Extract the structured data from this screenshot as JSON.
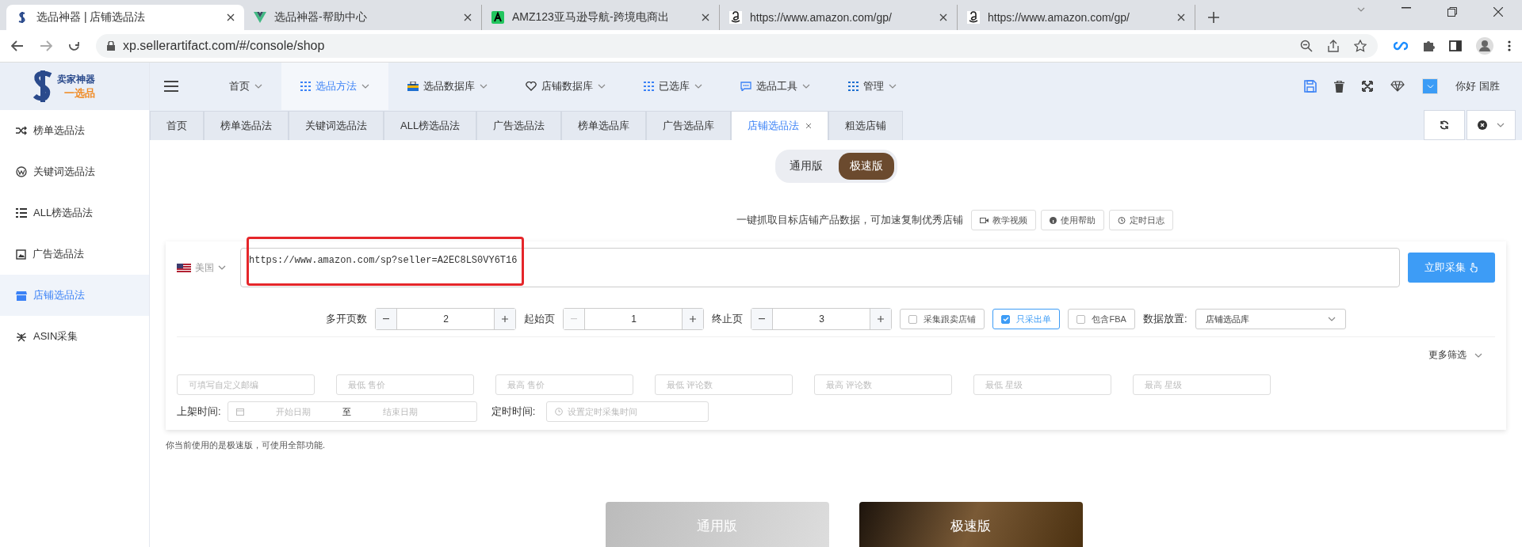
{
  "browser": {
    "tabs": [
      {
        "title": "选品神器 | 店铺选品法",
        "selected": true
      },
      {
        "title": "选品神器-帮助中心",
        "selected": false
      },
      {
        "title": "AMZ123亚马逊导航-跨境电商出",
        "selected": false
      },
      {
        "title": "https://www.amazon.com/gp/",
        "selected": false
      },
      {
        "title": "https://www.amazon.com/gp/",
        "selected": false
      }
    ],
    "address": "xp.sellerartifact.com/#/console/shop"
  },
  "header": {
    "logo_top": "卖家神器",
    "logo_bottom": "一选品",
    "nav": [
      {
        "label": "首页",
        "selected": false
      },
      {
        "label": "选品方法",
        "selected": true
      },
      {
        "label": "选品数据库",
        "selected": false
      },
      {
        "label": "店铺数据库",
        "selected": false
      },
      {
        "label": "已选库",
        "selected": false
      },
      {
        "label": "选品工具",
        "selected": false
      },
      {
        "label": "管理",
        "selected": false
      }
    ],
    "greeting": "你好 国胜"
  },
  "sidebar": {
    "items": [
      {
        "label": "榜单选品法",
        "selected": false
      },
      {
        "label": "关键词选品法",
        "selected": false
      },
      {
        "label": "ALL榜选品法",
        "selected": false
      },
      {
        "label": "广告选品法",
        "selected": false
      },
      {
        "label": "店铺选品法",
        "selected": true
      },
      {
        "label": "ASIN采集",
        "selected": false
      }
    ]
  },
  "page_tabs": [
    {
      "label": "首页",
      "selected": false
    },
    {
      "label": "榜单选品法",
      "selected": false
    },
    {
      "label": "关键词选品法",
      "selected": false
    },
    {
      "label": "ALL榜选品法",
      "selected": false
    },
    {
      "label": "广告选品法",
      "selected": false
    },
    {
      "label": "榜单选品库",
      "selected": false
    },
    {
      "label": "广告选品库",
      "selected": false
    },
    {
      "label": "店铺选品法",
      "selected": true
    },
    {
      "label": "粗选店铺",
      "selected": false
    }
  ],
  "mode_toggle": [
    {
      "label": "通用版",
      "selected": false
    },
    {
      "label": "极速版",
      "selected": true
    }
  ],
  "description": "一键抓取目标店铺产品数据，可加速复制优秀店铺",
  "help_buttons": [
    "教学视频",
    "使用帮助",
    "定时日志"
  ],
  "country": "美国",
  "url": "https://www.amazon.com/sp?seller=A2EC8LS0VY6T16",
  "submit": "立即采集",
  "steppers": [
    {
      "label": "多开页数",
      "value": "2",
      "minus_disabled": false
    },
    {
      "label": "起始页",
      "value": "1",
      "minus_disabled": true
    },
    {
      "label": "终止页",
      "value": "3",
      "minus_disabled": false
    }
  ],
  "checkboxes": [
    {
      "label": "采集跟卖店铺",
      "checked": false
    },
    {
      "label": "只采出单",
      "checked": true
    },
    {
      "label": "包含FBA",
      "checked": false
    }
  ],
  "data_target": {
    "label": "数据放置:",
    "value": "店铺选品库"
  },
  "more_filters": "更多筛选",
  "filters": [
    "可填写自定义邮编",
    "最低 售价",
    "最高 售价",
    "最低 评论数",
    "最高 评论数",
    "最低 星级",
    "最高 星级"
  ],
  "listing_time": {
    "label": "上架时间:",
    "start": "开始日期",
    "separator": "至",
    "end": "结束日期"
  },
  "schedule": {
    "label": "定时时间:",
    "placeholder": "设置定时采集时间"
  },
  "note": "你当前使用的是极速版，可使用全部功能.",
  "version_cards": [
    {
      "label": "通用版",
      "selected": false
    },
    {
      "label": "极速版",
      "selected": true
    }
  ]
}
